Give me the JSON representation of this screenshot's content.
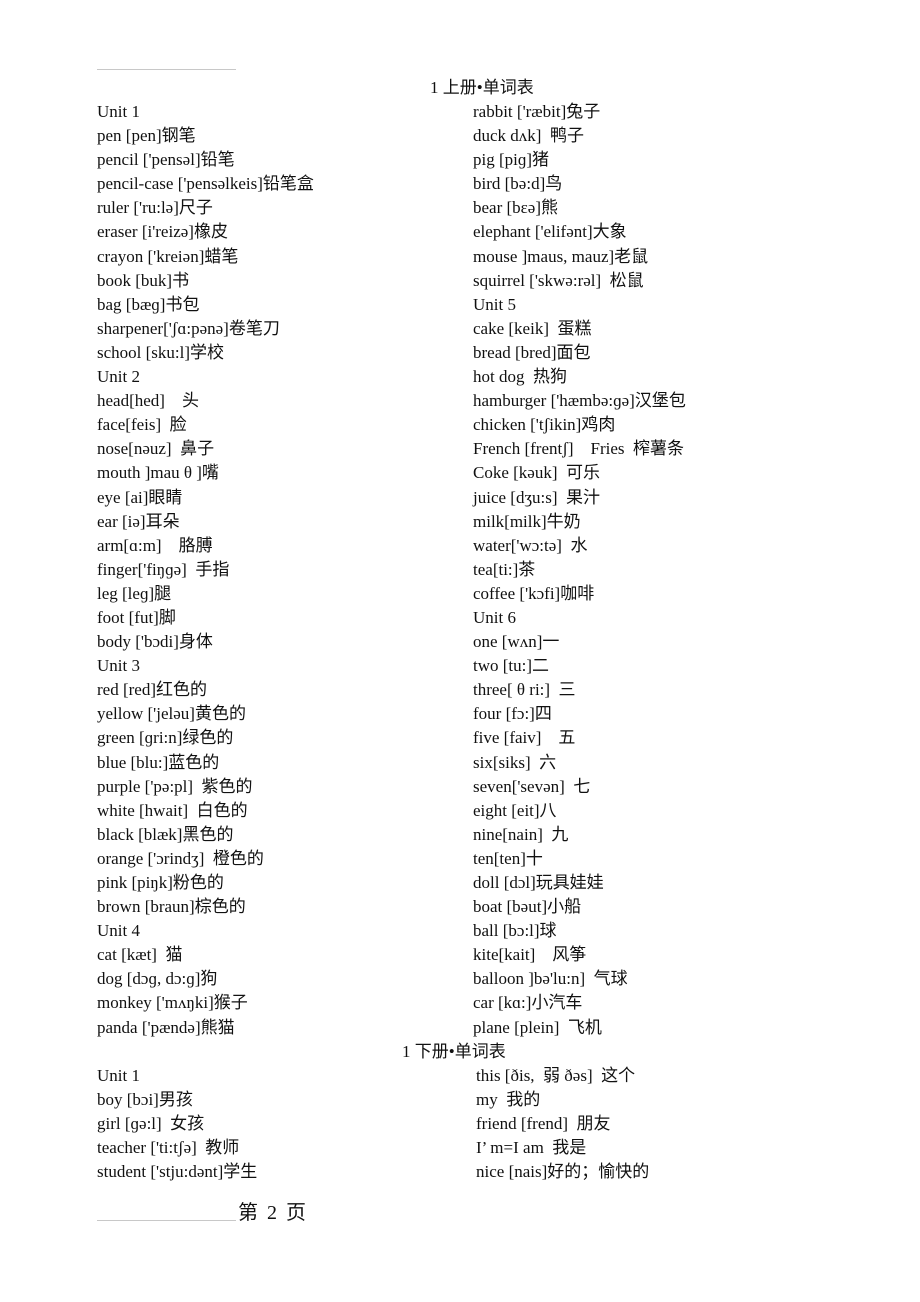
{
  "book1": {
    "title": "1 上册•单词表",
    "left": [
      "Unit 1",
      "pen [pen]钢笔",
      "pencil ['pensəl]铅笔",
      "pencil-case ['pensəlkeis]铅笔盒",
      "ruler ['ru:lə]尺子",
      "eraser [i'reizə]橡皮",
      "crayon ['kreiən]蜡笔",
      "book [buk]书",
      "bag [bæɡ]书包",
      "sharpener['ʃɑ:pənə]卷笔刀",
      "school [sku:l]学校",
      "Unit 2",
      "head[hed]    头",
      "face[feis]  脸",
      "nose[nəuz]  鼻子",
      "mouth ]mau θ ]嘴",
      "eye [ai]眼睛",
      "ear [iə]耳朵",
      "arm[ɑ:m]    胳膊",
      "finger['fiŋɡə]  手指",
      "leg [leɡ]腿",
      "foot [fut]脚",
      "body ['bɔdi]身体",
      "Unit 3",
      "red [red]红色的",
      "yellow ['jeləu]黄色的",
      "green [ɡri:n]绿色的",
      "blue [blu:]蓝色的",
      "purple ['pə:pl]  紫色的",
      "white [hwait]  白色的",
      "black [blæk]黑色的",
      "orange ['ɔrindʒ]  橙色的",
      "pink [piŋk]粉色的",
      "brown [braun]棕色的",
      "Unit 4",
      "cat [kæt]  猫",
      "dog [dɔɡ, dɔ:ɡ]狗",
      "monkey ['mʌŋki]猴子",
      "panda ['pændə]熊猫"
    ],
    "right": [
      "rabbit ['ræbit]兔子",
      "duck dʌk]  鸭子",
      "pig [piɡ]猪",
      "bird [bə:d]鸟",
      "bear [bɛə]熊",
      "elephant ['elifənt]大象",
      "mouse ]maus, mauz]老鼠",
      "squirrel ['skwə:rəl]  松鼠",
      "Unit 5",
      "cake [keik]  蛋糕",
      "bread [bred]面包",
      "hot dog  热狗",
      "hamburger ['hæmbə:ɡə]汉堡包",
      "chicken ['tʃikin]鸡肉",
      "French [frentʃ]    Fries  榨薯条",
      "Coke [kəuk]  可乐",
      "juice [dʒu:s]  果汁",
      "milk[milk]牛奶",
      "water['wɔ:tə]  水",
      "tea[ti:]茶",
      "coffee ['kɔfi]咖啡",
      "Unit 6",
      "one [wʌn]一",
      "two [tu:]二",
      "three[ θ ri:]  三",
      "four [fɔ:]四",
      "five [faiv]    五",
      "six[siks]  六",
      "seven['sevən]  七",
      "eight [eit]八",
      "nine[nain]  九",
      "ten[ten]十",
      "doll [dɔl]玩具娃娃",
      "boat [bəut]小船",
      "ball [bɔ:l]球",
      "kite[kait]    风筝",
      "balloon ]bə'lu:n]  气球",
      "car [kɑ:]小汽车",
      "plane [plein]  飞机"
    ]
  },
  "book2": {
    "title": "1 下册•单词表",
    "left": [
      "Unit 1",
      "boy [bɔi]男孩",
      "girl [ɡə:l]  女孩",
      "teacher ['ti:tʃə]  教师",
      "student ['stju:dənt]学生"
    ],
    "right": [
      "this [ðis,  弱 ðəs]  这个",
      "my  我的",
      "friend [frend]  朋友",
      "I’ m=I am  我是",
      "nice [nais]好的；愉快的"
    ]
  },
  "footer": {
    "page_label": "第 2 页"
  }
}
